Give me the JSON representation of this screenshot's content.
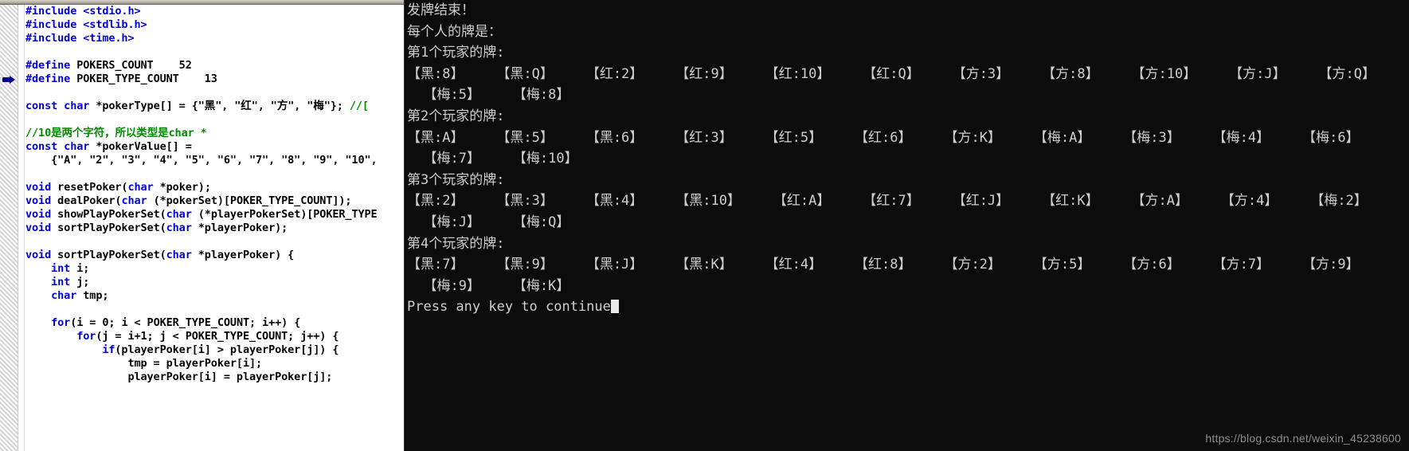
{
  "editor": {
    "name": "c-source-editor",
    "bookmark_marker": "bookmark-arrow",
    "code_lines": [
      "#include <stdio.h>",
      "#include <stdlib.h>",
      "#include <time.h>",
      "",
      "#define POKERS_COUNT    52",
      "#define POKER_TYPE_COUNT    13",
      "",
      "const char *pokerType[] = {\"黑\", \"红\", \"方\", \"梅\"}; //[",
      "",
      "//10是两个字符，所以类型是char *",
      "const char *pokerValue[] =",
      "    {\"A\", \"2\", \"3\", \"4\", \"5\", \"6\", \"7\", \"8\", \"9\", \"10\",",
      "",
      "void resetPoker(char *poker);",
      "void dealPoker(char (*pokerSet)[POKER_TYPE_COUNT]);",
      "void showPlayPokerSet(char (*playerPokerSet)[POKER_TYPE",
      "void sortPlayPokerSet(char *playerPoker);",
      "",
      "void sortPlayPokerSet(char *playerPoker) {",
      "    int i;",
      "    int j;",
      "    char tmp;",
      "",
      "    for(i = 0; i < POKER_TYPE_COUNT; i++) {",
      "        for(j = i+1; j < POKER_TYPE_COUNT; j++) {",
      "            if(playerPoker[i] > playerPoker[j]) {",
      "                tmp = playerPoker[i];",
      "                playerPoker[i] = playerPoker[j];"
    ]
  },
  "console": {
    "name": "program-output-console",
    "lines": [
      "发牌结束！",
      "每个人的牌是：",
      "第1个玩家的牌:",
      "【黑:8】    【黑:Q】    【红:2】    【红:9】    【红:10】    【红:Q】    【方:3】    【方:8】    【方:10】    【方:J】    【方:Q】",
      "  【梅:5】    【梅:8】",
      "第2个玩家的牌:",
      "【黑:A】    【黑:5】    【黑:6】    【红:3】    【红:5】    【红:6】    【方:K】    【梅:A】    【梅:3】    【梅:4】    【梅:6】",
      "  【梅:7】    【梅:10】",
      "第3个玩家的牌:",
      "【黑:2】    【黑:3】    【黑:4】    【黑:10】    【红:A】    【红:7】    【红:J】    【红:K】    【方:A】    【方:4】    【梅:2】",
      "  【梅:J】    【梅:Q】",
      "第4个玩家的牌:",
      "【黑:7】    【黑:9】    【黑:J】    【黑:K】    【红:4】    【红:8】    【方:2】    【方:5】    【方:6】    【方:7】    【方:9】",
      "  【梅:9】    【梅:K】"
    ],
    "prompt": "Press any key to continue",
    "cursor": "block-cursor"
  },
  "watermark": {
    "text": "https://blog.csdn.net/weixin_45238600"
  },
  "colors": {
    "editor_background": "#ffffff",
    "console_background": "#0c0c0c",
    "keyword": "#0000dd",
    "comment": "#008a00",
    "console_text": "#cfcfcf",
    "watermark_text": "#8d8d8d",
    "bookmark": "#00008f"
  }
}
